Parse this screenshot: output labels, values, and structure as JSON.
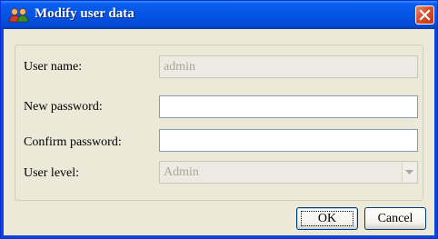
{
  "window": {
    "title": "Modify user data",
    "icon": "users-icon",
    "close_icon": "close-icon"
  },
  "form": {
    "username": {
      "label": "User name:",
      "value": "admin",
      "disabled": true
    },
    "new_password": {
      "label": "New password:",
      "value": ""
    },
    "confirm_password": {
      "label": "Confirm password:",
      "value": ""
    },
    "user_level": {
      "label": "User level:",
      "value": "Admin",
      "disabled": true
    }
  },
  "buttons": {
    "ok_label": "OK",
    "cancel_label": "Cancel"
  },
  "colors": {
    "titlebar": "#0554e3",
    "client": "#ece9d8",
    "close": "#d8502a"
  }
}
